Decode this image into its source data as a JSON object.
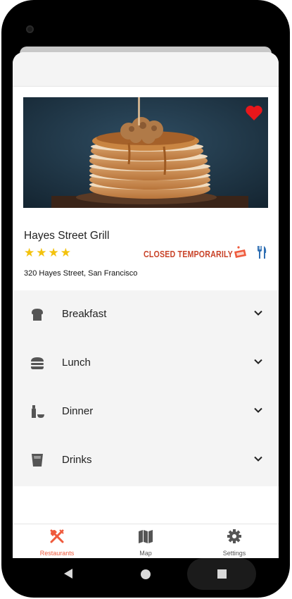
{
  "restaurant": {
    "name": "Hayes Street Grill",
    "rating": 4,
    "status": "CLOSED TEMPORARILY",
    "address": "320 Hayes Street, San Francisco"
  },
  "menu": {
    "items": [
      {
        "label": "Breakfast",
        "icon": "toast-icon"
      },
      {
        "label": "Lunch",
        "icon": "burger-icon"
      },
      {
        "label": "Dinner",
        "icon": "bottle-bowl-icon"
      },
      {
        "label": "Drinks",
        "icon": "glass-icon"
      }
    ]
  },
  "tabs": [
    {
      "label": "Restaurants",
      "icon": "fork-knife-icon",
      "active": true
    },
    {
      "label": "Map",
      "icon": "map-icon",
      "active": false
    },
    {
      "label": "Settings",
      "icon": "gear-icon",
      "active": false
    }
  ],
  "colors": {
    "accent": "#ef5a3c",
    "status": "#c9442a",
    "star": "#f3c20d",
    "heart": "#e8171b",
    "icon_blue": "#2f6fb3",
    "menu_bg": "#f4f4f4"
  }
}
